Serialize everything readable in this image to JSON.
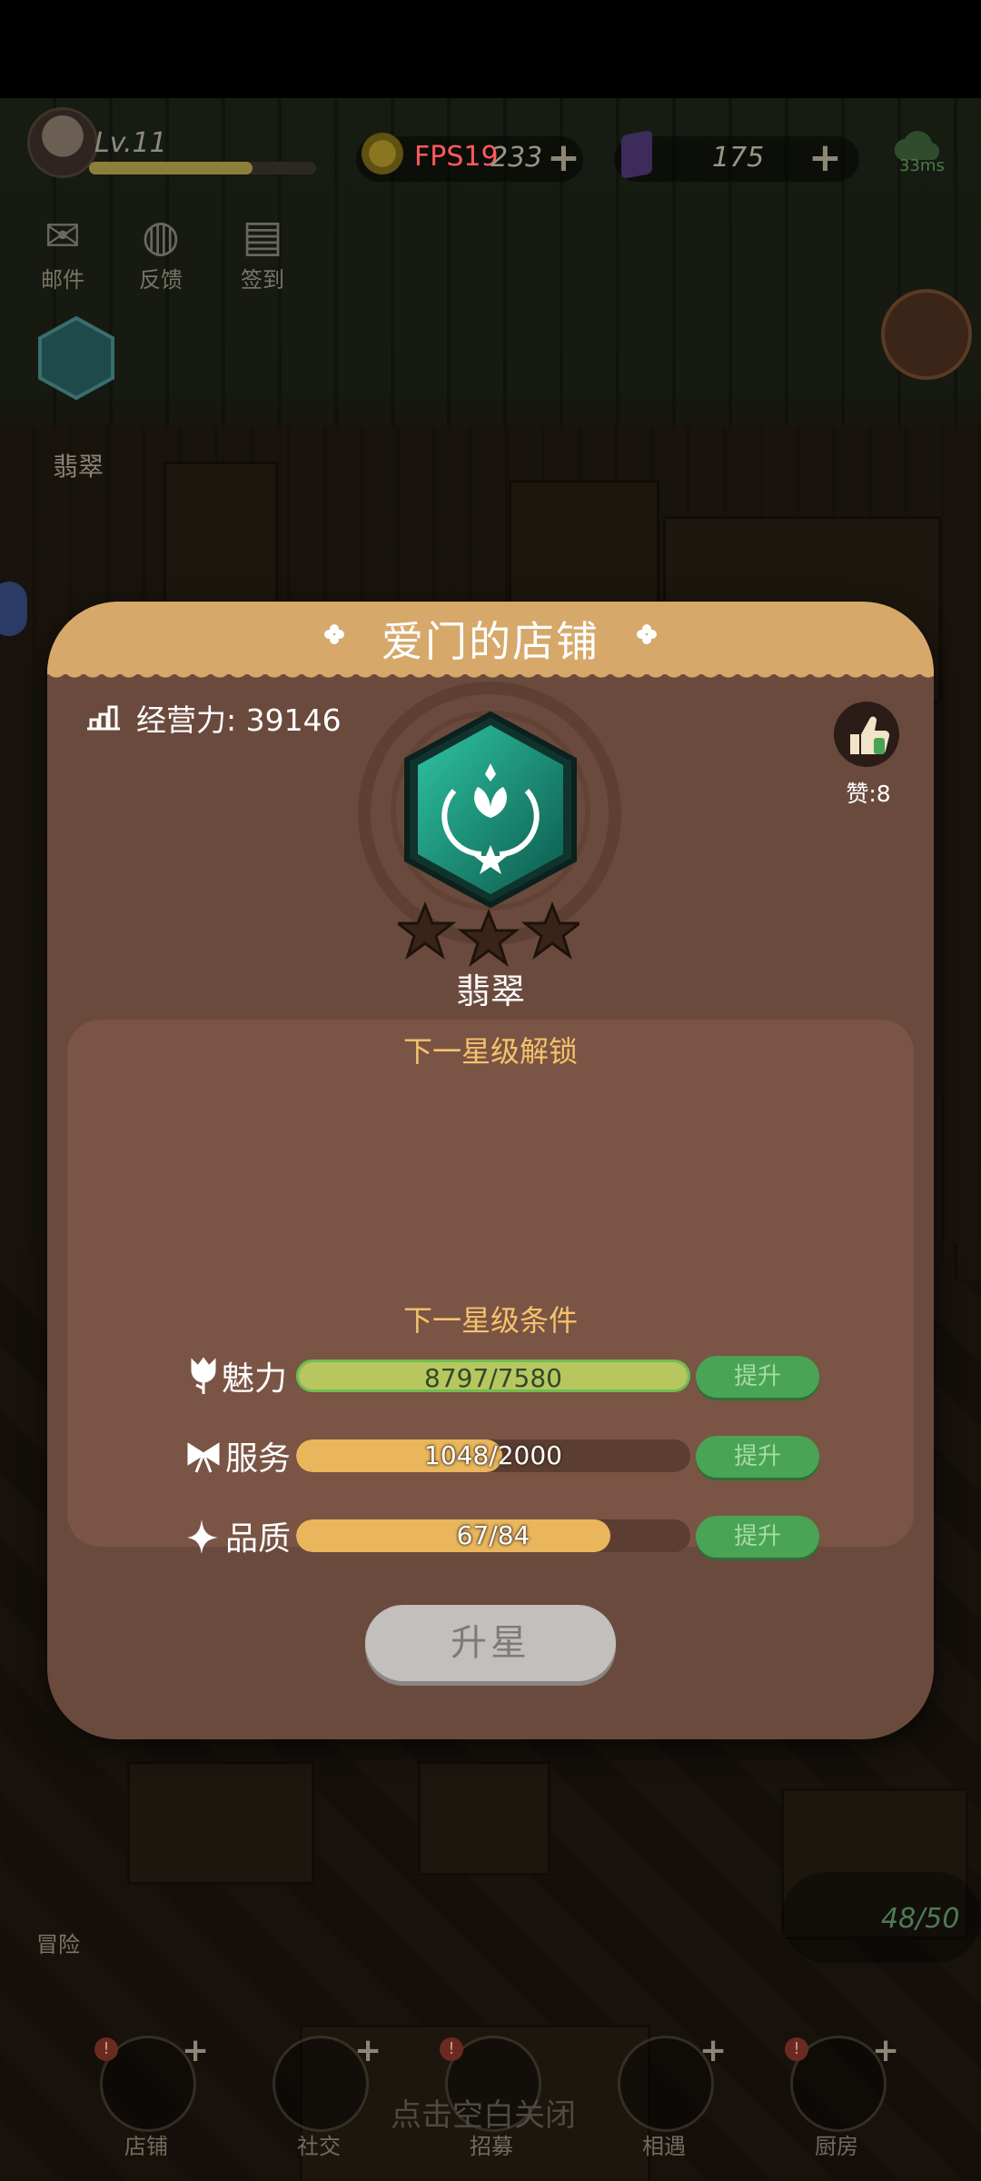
{
  "hud": {
    "level": "Lv.11",
    "level_exp_fraction": 0.72,
    "coins_partial": "233",
    "fps": "FPS19",
    "gems": "175",
    "ping": "33ms"
  },
  "side_menu": [
    {
      "label": "邮件",
      "icon": "mail-icon"
    },
    {
      "label": "反馈",
      "icon": "globe-icon"
    },
    {
      "label": "签到",
      "icon": "calendar-icon"
    }
  ],
  "left_rank_label": "翡翠",
  "bottom_nav": [
    {
      "label": "店铺",
      "icon": "shop-icon"
    },
    {
      "label": "社交",
      "icon": "coffee-icon"
    },
    {
      "label": "招募",
      "icon": "cup-icon"
    },
    {
      "label": "相遇",
      "icon": "handshake-icon"
    },
    {
      "label": "厨房",
      "icon": "pan-icon"
    }
  ],
  "adventure_label": "冒险",
  "hint_text": "点击空白关闭",
  "energy": "48/50",
  "dialog": {
    "title": "爱门的店铺",
    "power_label": "经营力: 39146",
    "likes": "赞:8",
    "rank_name": "翡翠",
    "stars_filled": 0,
    "stars_total": 3,
    "next_unlock_title": "下一星级解锁",
    "next_condition_title": "下一星级条件",
    "attributes": [
      {
        "name": "魅力",
        "value_text": "8797/7580",
        "progress": 1.0,
        "complete": true,
        "button": "提升",
        "icon": "tulip-icon"
      },
      {
        "name": "服务",
        "value_text": "1048/2000",
        "progress": 0.524,
        "complete": false,
        "button": "提升",
        "icon": "bow-icon"
      },
      {
        "name": "品质",
        "value_text": "67/84",
        "progress": 0.798,
        "complete": false,
        "button": "提升",
        "icon": "sparkle-icon"
      }
    ],
    "star_up_button": "升星"
  },
  "colors": {
    "dialog_bg": "#6b4a3e",
    "header_bg": "#d6a86a",
    "panel_title": "#f5c26b",
    "bar_fill": "#e9b65c",
    "button_green": "#4aa456",
    "disabled_button": "#c2bfbc"
  }
}
